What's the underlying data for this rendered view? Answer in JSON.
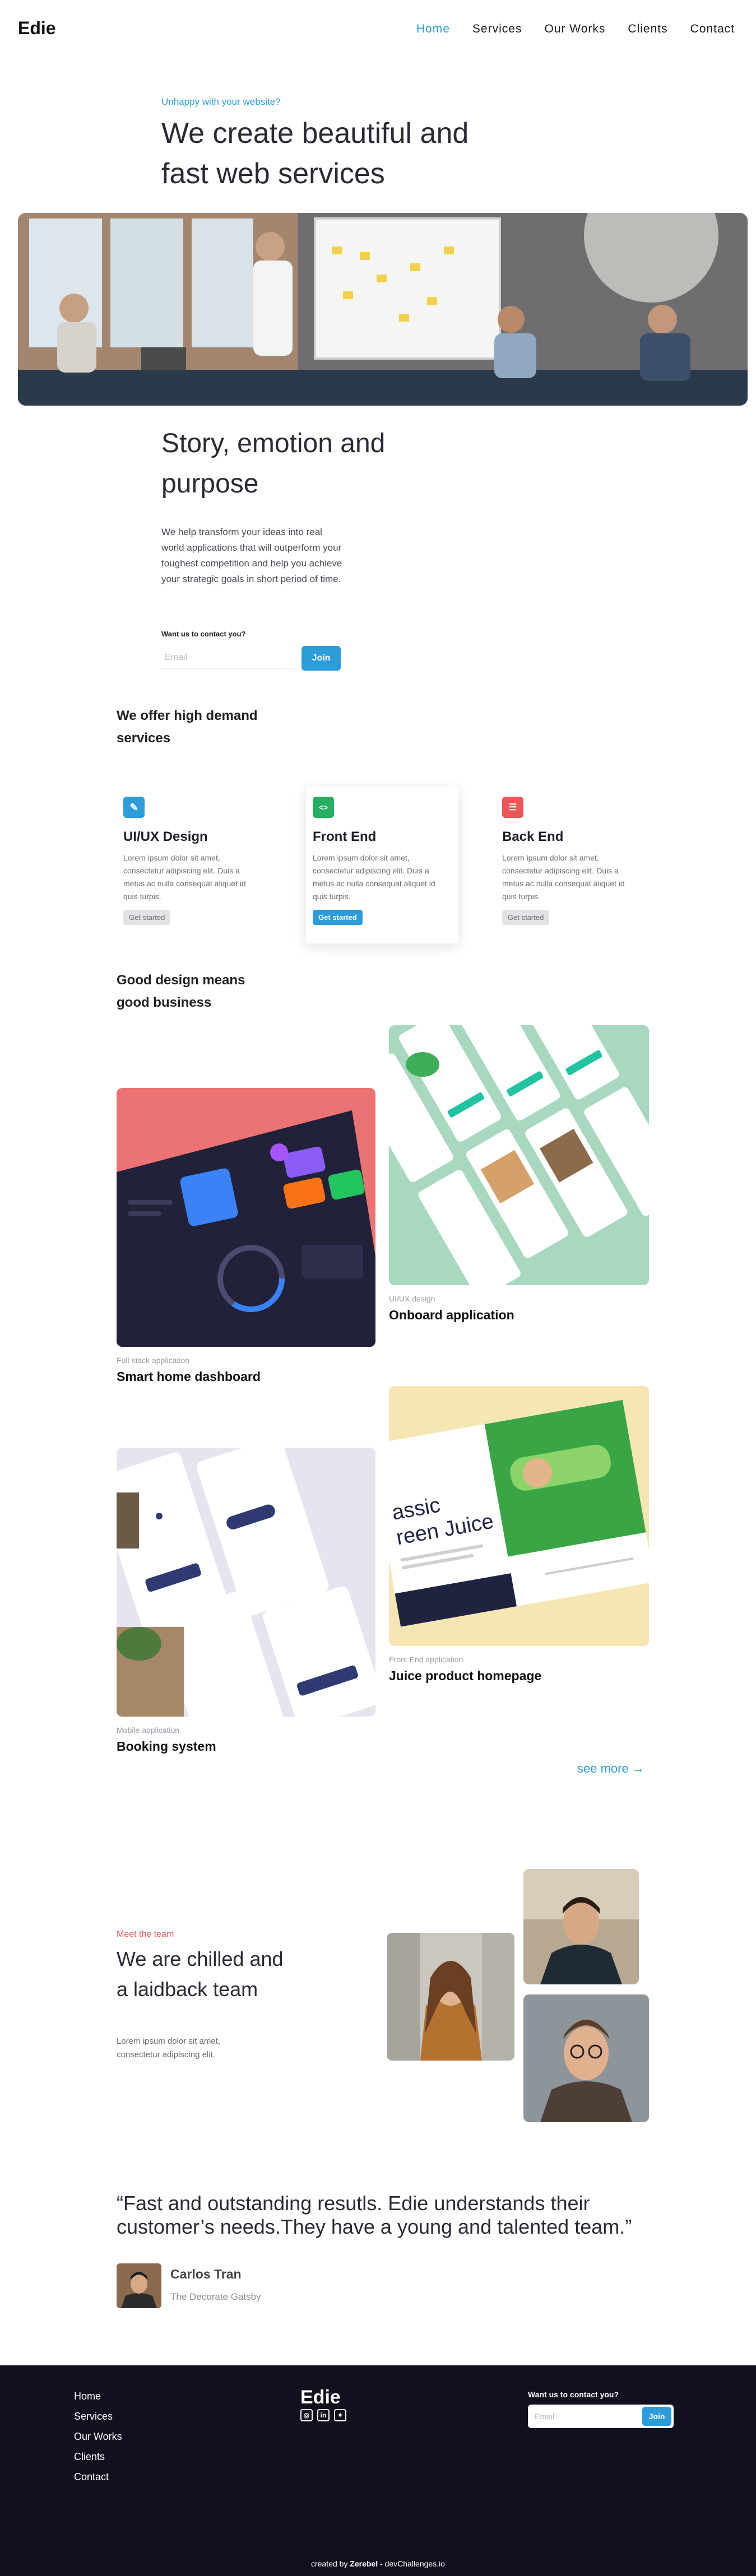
{
  "header": {
    "logo": "Edie",
    "nav": [
      {
        "label": "Home",
        "active": true
      },
      {
        "label": "Services",
        "active": false
      },
      {
        "label": "Our Works",
        "active": false
      },
      {
        "label": "Clients",
        "active": false
      },
      {
        "label": "Contact",
        "active": false
      }
    ]
  },
  "hero": {
    "kicker": "Unhappy with your website?",
    "title": "We create beautiful and fast web services",
    "story_title": "Story, emotion and purpose",
    "story_text": "We help transform your ideas into real world applications that will outperform your toughest competition and help you achieve your strategic goals in short period of time.",
    "contact_label": "Want us to contact you?",
    "email_placeholder": "Email",
    "join_label": "Join"
  },
  "services": {
    "title": "We offer high demand services",
    "cards": [
      {
        "icon": "pencil-icon",
        "color": "#2d9cdb",
        "title": "UI/UX Design",
        "text": "Lorem ipsum dolor sit amet, consectetur adipiscing elit. Duis a metus ac nulla consequat aliquet id quis turpis.",
        "button": "Get started",
        "highlight": false
      },
      {
        "icon": "code-icon",
        "color": "#27ae60",
        "title": "Front End",
        "text": "Lorem ipsum dolor sit amet, consectetur adipiscing elit. Duis a metus ac nulla consequat aliquet id quis turpis.",
        "button": "Get started",
        "highlight": true
      },
      {
        "icon": "server-icon",
        "color": "#eb5757",
        "title": "Back End",
        "text": "Lorem ipsum dolor sit amet, consectetur adipiscing elit. Duis a metus ac nulla consequat aliquet id quis turpis.",
        "button": "Get started",
        "highlight": false
      }
    ]
  },
  "works": {
    "title": "Good design means good business",
    "projects": [
      {
        "category": "Full stack application",
        "name": "Smart home dashboard"
      },
      {
        "category": "UI/UX design",
        "name": "Onboard application"
      },
      {
        "category": "Mobile application",
        "name": "Booking system"
      },
      {
        "category": "Front End application",
        "name": "Juice product homepage"
      }
    ],
    "juice_text": "assic reen Juice",
    "see_more": "see more →"
  },
  "team": {
    "kicker": "Meet the team",
    "title": "We are chilled and a laidback team",
    "text": "Lorem ipsum dolor sit amet, consectetur adipiscing elit."
  },
  "testimonial": {
    "quote": "“Fast and outstanding resutls. Edie understands their customer’s needs.They have a young and talented team.”",
    "author": "Carlos Tran",
    "company": "The Decorate Gatsby"
  },
  "footer": {
    "nav": [
      "Home",
      "Services",
      "Our Works",
      "Clients",
      "Contact"
    ],
    "logo": "Edie",
    "social": [
      "instagram-icon",
      "linkedin-icon",
      "twitter-icon"
    ],
    "contact_label": "Want us to contact you?",
    "email_placeholder": "Email",
    "join_label": "Join",
    "credit_prefix": "created by",
    "credit_author": "Zerebel",
    "credit_suffix": "- devChallenges.io"
  },
  "colors": {
    "accent": "#2d9cdb",
    "footer_bg": "#12101f",
    "team_kicker": "#eb5757"
  }
}
